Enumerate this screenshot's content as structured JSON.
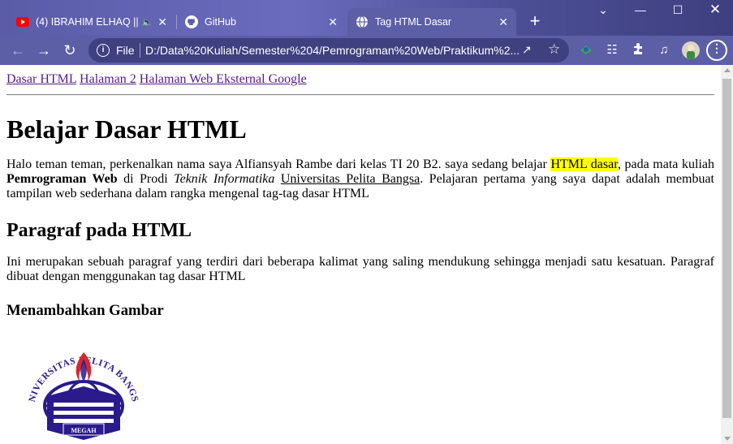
{
  "browser": {
    "tabs": [
      {
        "title": "(4) IBRAHIM ELHAQ || S",
        "icon": "youtube-icon",
        "audio": true
      },
      {
        "title": "GitHub",
        "icon": "github-icon"
      },
      {
        "title": "Tag HTML Dasar",
        "icon": "globe-icon",
        "active": true
      }
    ],
    "address": {
      "scheme_label": "File",
      "url": "D:/Data%20Kuliah/Semester%204/Pemrograman%20Web/Praktikum%2..."
    },
    "colors": {
      "frame": "#5c5ea6",
      "omnibox": "#3f4080"
    }
  },
  "page": {
    "nav_links": [
      "Dasar HTML",
      "Halaman 2",
      "Halaman Web Eksternal Google"
    ],
    "h1": "Belajar Dasar HTML",
    "intro": {
      "part1": "Halo teman teman, perkenalkan nama saya Alfiansyah Rambe dari kelas TI 20 B2. saya sedang belajar ",
      "highlight": "HTML dasar",
      "part2": ", pada mata kuliah ",
      "bold": "Pemrograman Web",
      "part3": " di Prodi ",
      "italic": "Teknik Informatika",
      "part4": " ",
      "underline": "Universitas Pelita Bangsa",
      "part5": ". Pelajaran pertama yang saya dapat adalah membuat tampilan web sederhana dalam rangka mengenal tag-tag dasar HTML"
    },
    "h2": "Paragraf pada HTML",
    "paragraph": "Ini merupakan sebuah paragraf yang terdiri dari beberapa kalimat yang saling mendukung sehingga menjadi satu kesatuan. Paragraf dibuat dengan menggunakan tag dasar HTML",
    "h3": "Menambahkan Gambar",
    "logo": {
      "arc_text": "UNIVERSITAS PELITA BANGSA",
      "motto": "MEGAH",
      "color": "#2a1a8c",
      "flame_color": "#d6282e"
    }
  }
}
